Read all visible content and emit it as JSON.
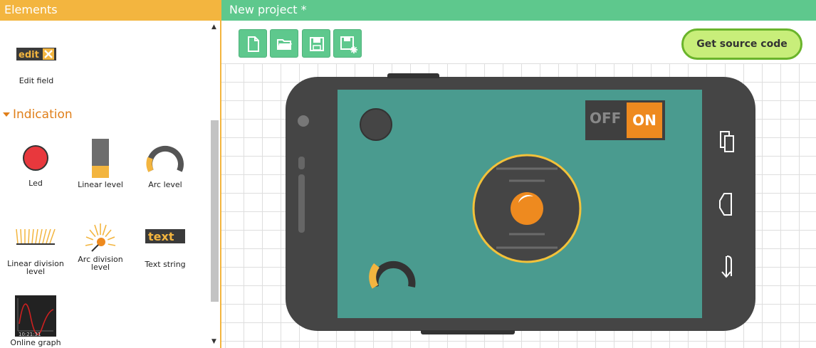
{
  "left_panel": {
    "title": "Elements",
    "edit_field": {
      "icon_text": "edit",
      "label": "Edit field"
    },
    "section_title": "Indication",
    "items": [
      {
        "label": "Led",
        "icon": "led-icon"
      },
      {
        "label": "Linear level",
        "icon": "linear-level-icon"
      },
      {
        "label": "Arc level",
        "icon": "arc-level-icon"
      },
      {
        "label": "Linear division level",
        "icon": "linear-division-level-icon"
      },
      {
        "label": "Arc division level",
        "icon": "arc-division-level-icon"
      },
      {
        "label": "Text string",
        "icon": "text-string-icon",
        "icon_text": "text"
      },
      {
        "label": "Online graph",
        "icon": "online-graph-icon",
        "icon_text": "10:21:31"
      }
    ]
  },
  "editor": {
    "title": "New project *",
    "toolbar": [
      {
        "icon": "new-file-icon"
      },
      {
        "icon": "open-folder-icon"
      },
      {
        "icon": "save-icon"
      },
      {
        "icon": "save-as-icon"
      }
    ],
    "source_button": "Get source code"
  },
  "phone_widgets": {
    "switch": {
      "off_label": "OFF",
      "on_label": "ON",
      "state": "on"
    },
    "arc_level_fraction": 0.3
  },
  "colors": {
    "elements_header": "#f3b53f",
    "project_header": "#5ec88d",
    "screen_bg": "#4a9b8f",
    "accent_orange": "#ee8a1f",
    "source_button_bg": "#c8ee7a"
  }
}
